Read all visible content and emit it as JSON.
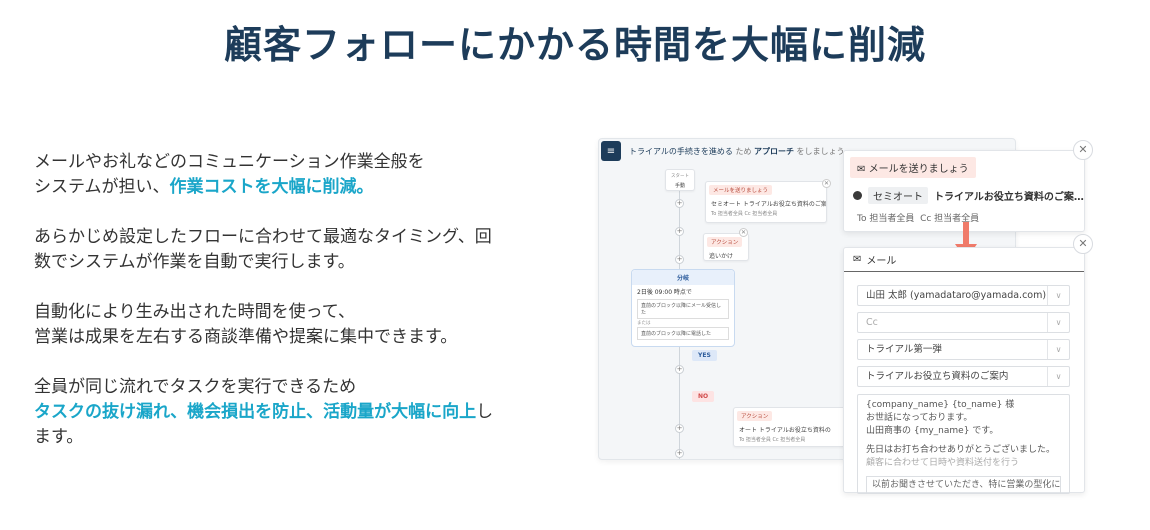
{
  "headline": "顧客フォローにかかる時間を大幅に削減",
  "paragraphs": {
    "p1_line1": "メールやお礼などのコミュニケーション作業全般を",
    "p1_line2": "システムが担い、",
    "p1_highlight": "作業コストを大幅に削減。",
    "p2_line1": "あらかじめ設定したフローに合わせて最適なタイミング、回",
    "p2_line2": "数でシステムが作業を自動で実行します。",
    "p3_line1": "自動化により生み出された時間を使って、",
    "p3_line2": "営業は成果を左右する商談準備や提案に集中できます。",
    "p4_line1": "全員が同じ流れでタスクを実行できるため",
    "p4_highlight": "タスクの抜け漏れ、機会損出を防止、活動量が大幅に向上",
    "p4_tail": "し",
    "p4_line3": "ます。"
  },
  "mock": {
    "title_prefix": "トライアルの手続きを進める",
    "title_mid": " ため ",
    "title_bold": "アプローチ",
    "title_suffix": " をしましょう",
    "start_label": "スタート",
    "start_sub": "手動",
    "mail_node_head": "メールを送りましょう",
    "mail_node_row": "セミオート  トライアルお役立ち資料のご案内",
    "mail_node_sub": "To 担当者全員  Cc 担当者全員",
    "action_head": "アクション",
    "action_row": "追いかけ",
    "branch_head": "分岐",
    "branch_cond": "2日後 09:00 時点で",
    "branch_box1": "直前のブロック以降にメール受信した",
    "branch_label2": "または",
    "branch_box2": "直前のブロック以降に電話した",
    "yes": "YES",
    "no": "NO",
    "action2_head": "アクション",
    "action2_row": "オート  トライアルお役立ち資料の",
    "action2_sub": "To 担当者全員  Cc 担当者全員"
  },
  "card1": {
    "head": "メールを送りましょう",
    "chip": "セミオート",
    "title": "トライアルお役立ち資料のご案…",
    "to": "To 担当者全員",
    "cc": "Cc 担当者全員"
  },
  "card2": {
    "head": "メール",
    "to_value": "山田 太郎 (yamadataro@yamada.com)",
    "cc_placeholder": "Cc",
    "template": "トライアル第一弾",
    "subject": "トライアルお役立ち資料のご案内",
    "body_line1": "{company_name} {to_name} 様",
    "body_line2": "お世話になっております。",
    "body_line3": "山田商事の {my_name} です。",
    "body_line4": "先日はお打ち合わせありがとうございました。",
    "body_line5": "顧客に合わせて日時や資料送付を行う",
    "body_quote": "以前お聞きさせていただき、特に営業の型化に興"
  },
  "icons": {
    "close": "✕",
    "plus": "+",
    "chevron": "∨",
    "mail": "✉",
    "menu": "≡"
  },
  "colors": {
    "accent": "#1aa6c9",
    "navy": "#1d3c5a",
    "arrow": "#f07b6a"
  }
}
